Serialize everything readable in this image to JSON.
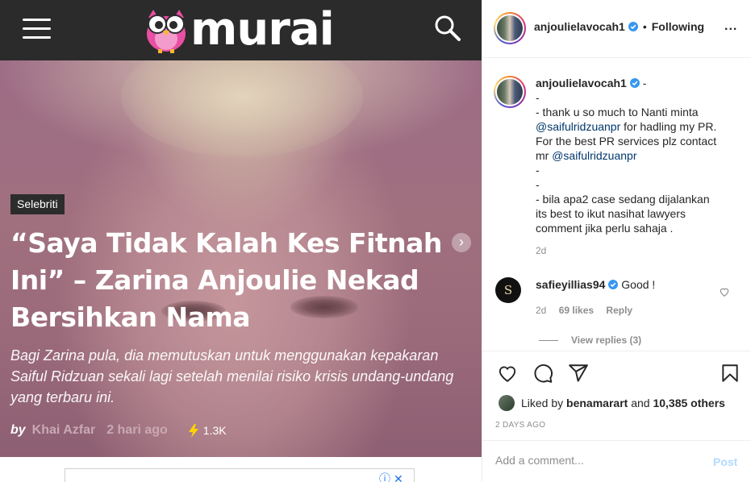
{
  "murai": {
    "logo_text": "murai",
    "category_tag": "Selebriti",
    "headline": "“Saya Tidak Kalah Kes Fitnah Ini” – Zarina Anjoulie Nekad Bersihkan Nama",
    "summary": "Bagi Zarina pula, dia memutuskan untuk menggunakan kepakaran Saiful Ridzuan sekali lagi setelah menilai risiko krisis undang-undang yang terbaru ini.",
    "by_label": "by",
    "author": "Khai Azfar",
    "posted": "2 hari ago",
    "views": "1.3K",
    "icons": [
      "menu-icon",
      "search-icon",
      "bolt-icon",
      "chevron-right-icon",
      "info-icon",
      "close-icon"
    ]
  },
  "instagram": {
    "header": {
      "username": "anjoulielavocah1",
      "separator": "•",
      "follow_status": "Following",
      "more": "..."
    },
    "caption": {
      "username": "anjoulielavocah1",
      "lines": [
        "-",
        "-",
        "- thank u so much to Nanti minta",
        "@saifulridzuanpr",
        " for hadling my PR.",
        "For the best PR services plz contact",
        "mr ",
        "@saifulridzuanpr",
        "-",
        "-",
        "- bila apa2 case sedang dijalankan",
        "its best to ikut nasihat lawyers",
        "comment jika perlu sahaja ."
      ],
      "age": "2d"
    },
    "comment": {
      "username": "safieyillias94",
      "text": "Good !",
      "age": "2d",
      "likes": "69 likes",
      "reply": "Reply",
      "avatar_glyph": "S"
    },
    "view_replies": "View replies (3)",
    "liked_by_prefix": "Liked by",
    "liked_by_user": "benamarart",
    "liked_by_and": "and",
    "liked_by_others": "10,385 others",
    "time_ago": "2 DAYS AGO",
    "comment_placeholder": "Add a comment...",
    "post_label": "Post",
    "accent": "#0095f6",
    "verified_color": "#3897f0"
  }
}
